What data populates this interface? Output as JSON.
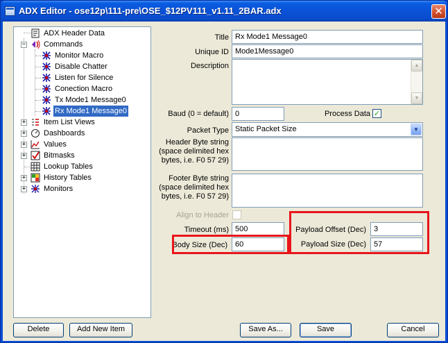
{
  "window": {
    "title": "ADX Editor - ose12p\\111-pre\\OSE_$12PV111_v1.11_2BAR.adx",
    "close_glyph": "✕",
    "accent": "#0a52d8"
  },
  "tree": {
    "items": [
      {
        "label": "ADX Header Data",
        "icon": "document-icon"
      },
      {
        "label": "Commands",
        "icon": "commands-icon",
        "expander": "−"
      },
      {
        "label": "Monitor Macro",
        "icon": "macro-icon"
      },
      {
        "label": "Disable Chatter",
        "icon": "macro-icon"
      },
      {
        "label": "Listen for Silence",
        "icon": "macro-icon"
      },
      {
        "label": "Conection Macro",
        "icon": "macro-icon"
      },
      {
        "label": "Tx Mode1 Message0",
        "icon": "macro-icon"
      },
      {
        "label": "Rx Mode1 Message0",
        "icon": "macro-icon",
        "selected": true
      },
      {
        "label": "Item List Views",
        "icon": "list-icon",
        "expander": "+"
      },
      {
        "label": "Dashboards",
        "icon": "dashboard-icon",
        "expander": "+"
      },
      {
        "label": "Values",
        "icon": "values-icon",
        "expander": "+"
      },
      {
        "label": "Bitmasks",
        "icon": "bitmask-icon",
        "expander": "+"
      },
      {
        "label": "Lookup Tables",
        "icon": "table-icon"
      },
      {
        "label": "History Tables",
        "icon": "history-icon",
        "expander": "+"
      },
      {
        "label": "Monitors",
        "icon": "monitor-icon",
        "expander": "+"
      }
    ]
  },
  "form": {
    "title": {
      "label": "Title",
      "value": "Rx Mode1 Message0"
    },
    "unique_id": {
      "label": "Unique ID",
      "value": "Mode1Message0"
    },
    "description": {
      "label": "Description",
      "value": ""
    },
    "baud": {
      "label": "Baud (0 = default)",
      "value": "0"
    },
    "process_data": {
      "label": "Process Data",
      "checked": true,
      "check_glyph": "✓"
    },
    "packet_type": {
      "label": "Packet Type",
      "value": "Static Packet Size"
    },
    "header_bytes": {
      "label_lines": [
        "Header Byte string",
        "(space delimited hex",
        "bytes, i.e. F0 57 29)"
      ],
      "value": ""
    },
    "footer_bytes": {
      "label_lines": [
        "Footer Byte string",
        "(space delimited hex",
        "bytes, i.e. F0 57 29)"
      ],
      "value": ""
    },
    "align_to_header": {
      "label": "Align to Header",
      "checked": false
    },
    "timeout": {
      "label": "Timeout (ms)",
      "value": "500"
    },
    "body_size": {
      "label": "Body Size (Dec)",
      "value": "60"
    },
    "payload_offset": {
      "label": "Payload Offset (Dec)",
      "value": "3"
    },
    "payload_size": {
      "label": "Payload Size (Dec)",
      "value": "57"
    }
  },
  "buttons": {
    "delete": "Delete",
    "add_new_item": "Add New Item",
    "save_as": "Save As...",
    "save": "Save",
    "cancel": "Cancel"
  },
  "highlight_color": "#e8151b"
}
